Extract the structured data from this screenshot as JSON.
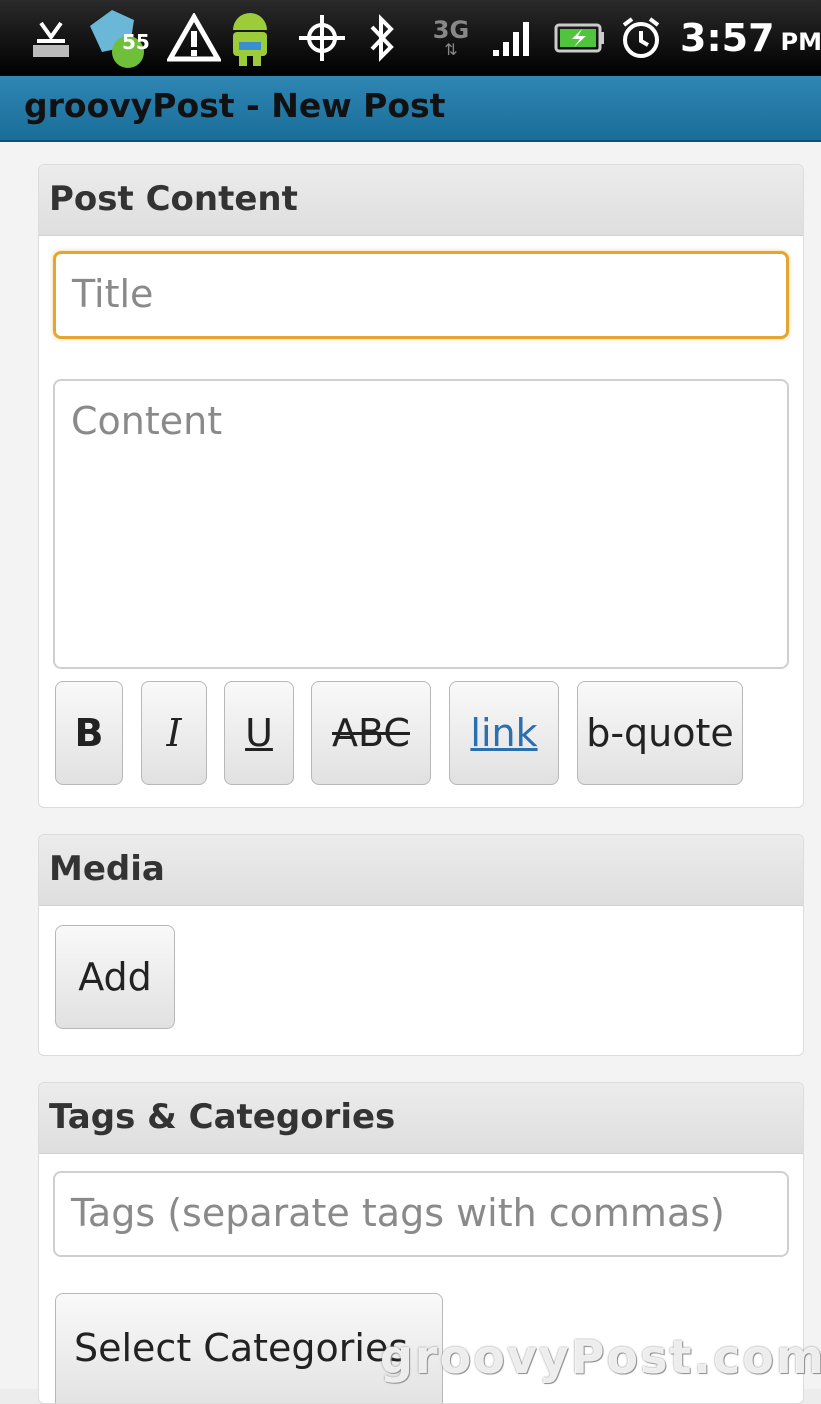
{
  "status_bar": {
    "icons": [
      "usb-icon",
      "notification-badge-icon",
      "warning-icon",
      "android-icon",
      "gps-icon",
      "bluetooth-icon",
      "3g-icon",
      "signal-icon",
      "battery-icon",
      "alarm-icon"
    ],
    "badge_count": "55",
    "network": "3G",
    "time": "3:57",
    "ampm": "PM"
  },
  "title_bar": {
    "title": "groovyPost - New Post"
  },
  "post_content": {
    "header": "Post Content",
    "title_placeholder": "Title",
    "content_placeholder": "Content",
    "format_buttons": [
      "B",
      "I",
      "U",
      "ABC",
      "link",
      "b-quote"
    ]
  },
  "media": {
    "header": "Media",
    "add_label": "Add"
  },
  "tags_categories": {
    "header": "Tags & Categories",
    "tags_placeholder": "Tags (separate tags with commas)",
    "select_categories_label": "Select Categories"
  },
  "watermark": "groovyPost.com",
  "colors": {
    "title_bar": "#1f76a6",
    "focus_border": "#e6a530",
    "link": "#2a6fb0"
  }
}
